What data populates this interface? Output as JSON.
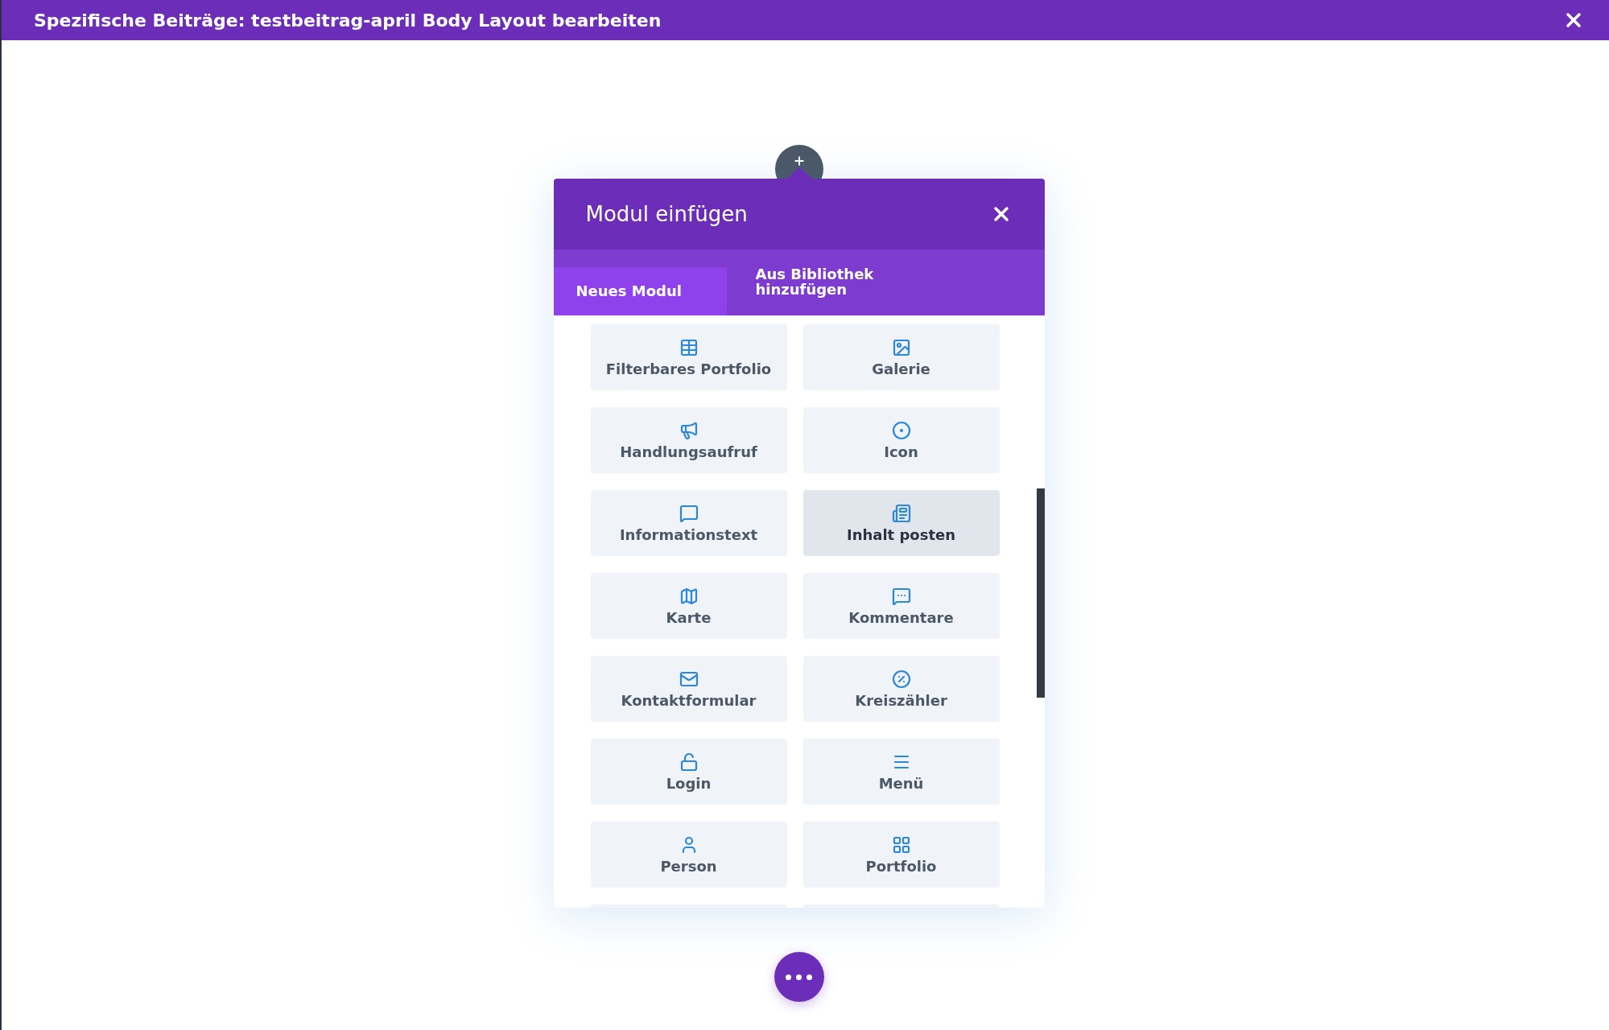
{
  "window": {
    "title": "Spezifische Beiträge: testbeitrag-april Body Layout bearbeiten"
  },
  "dialog": {
    "title": "Modul einfügen",
    "tabs": [
      {
        "label": "Neues Modul",
        "selected": true
      },
      {
        "label": "Aus Bibliothek hinzufügen",
        "selected": false
      }
    ],
    "modules": [
      {
        "label": "Filterbares Portfolio",
        "selected": false
      },
      {
        "label": "Galerie",
        "selected": false
      },
      {
        "label": "Handlungsaufruf",
        "selected": false
      },
      {
        "label": "Icon",
        "selected": false
      },
      {
        "label": "Informationstext",
        "selected": false
      },
      {
        "label": "Inhalt posten",
        "selected": true
      },
      {
        "label": "Karte",
        "selected": false
      },
      {
        "label": "Kommentare",
        "selected": false
      },
      {
        "label": "Kontaktformular",
        "selected": false
      },
      {
        "label": "Kreiszähler",
        "selected": false
      },
      {
        "label": "Login",
        "selected": false
      },
      {
        "label": "Menü",
        "selected": false
      },
      {
        "label": "Person",
        "selected": false
      },
      {
        "label": "Portfolio",
        "selected": false
      }
    ]
  }
}
